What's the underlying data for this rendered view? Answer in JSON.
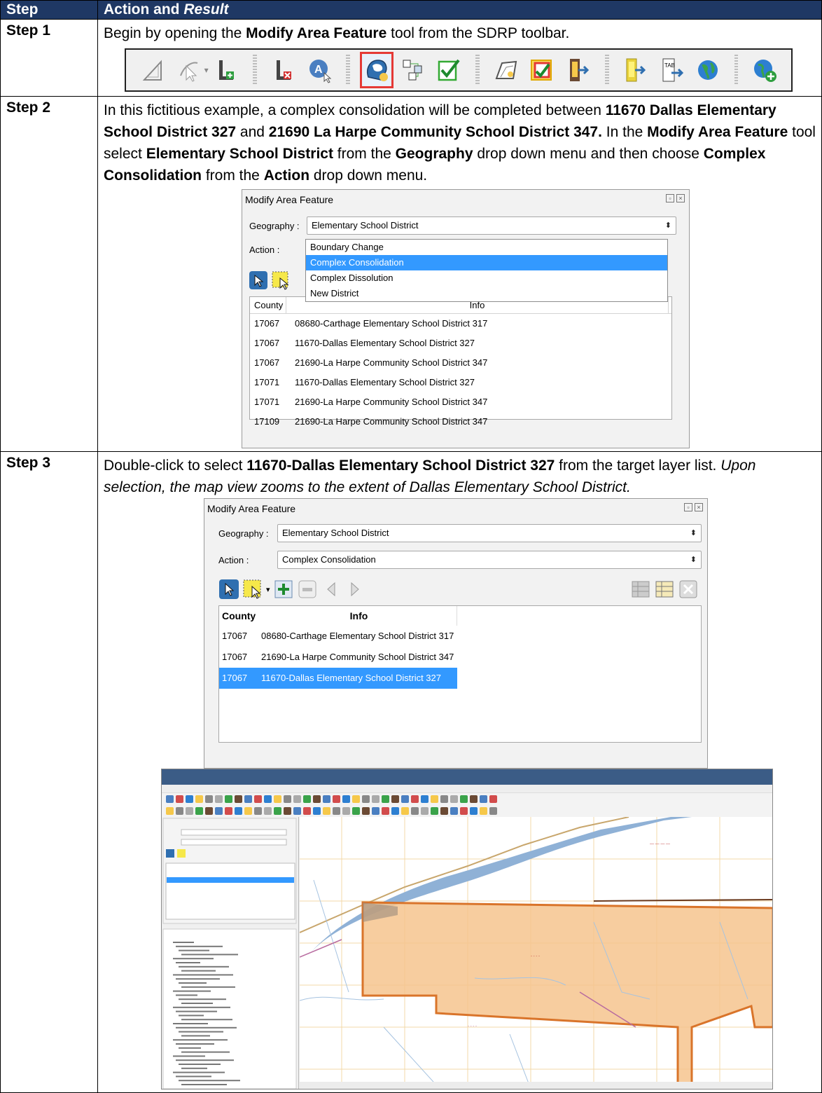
{
  "header": {
    "col_step": "Step",
    "col_action_a": "Action and ",
    "col_action_b": "Result"
  },
  "steps": [
    {
      "label": "Step 1",
      "text": [
        {
          "t": "Begin by opening the "
        },
        {
          "b": "Modify Area Feature"
        },
        {
          "t": " tool from the SDRP toolbar."
        }
      ],
      "toolbar_icons": [
        "measure-icon",
        "select-arrow-icon",
        "add-layer-icon",
        "remove-layer-icon",
        "label-icon",
        "modify-area-feature-icon",
        "topology-icon",
        "review-check-icon",
        "edit-shape-icon",
        "validate-icon",
        "export-icon",
        "import-icon",
        "tab-export-icon",
        "globe-icon",
        "add-globe-icon"
      ]
    },
    {
      "label": "Step 2",
      "text": [
        {
          "t": "In this fictitious example, a complex consolidation will be completed between "
        },
        {
          "b": "11670 Dallas Elementary School District 327"
        },
        {
          "t": " and "
        },
        {
          "b": "21690 La Harpe Community School District 347."
        },
        {
          "t": " In the "
        },
        {
          "b": "Modify Area Feature"
        },
        {
          "t": " tool select "
        },
        {
          "b": "Elementary School District"
        },
        {
          "t": " from the "
        },
        {
          "b": "Geography"
        },
        {
          "t": " drop down menu and then choose "
        },
        {
          "b": "Complex Consolidation"
        },
        {
          "t": " from the "
        },
        {
          "b": "Action"
        },
        {
          "t": " drop down menu."
        }
      ],
      "dialog": {
        "title": "Modify Area Feature",
        "geography_label": "Geography :",
        "geography_value": "Elementary School District",
        "action_label": "Action :",
        "action_options": [
          "Boundary Change",
          "Complex Consolidation",
          "Complex Dissolution",
          "New District"
        ],
        "action_selected": "Complex Consolidation",
        "col_county": "County",
        "col_info": "Info",
        "rows": [
          {
            "county": "17067",
            "info": "08680-Carthage Elementary School District 317"
          },
          {
            "county": "17067",
            "info": "11670-Dallas Elementary School District 327"
          },
          {
            "county": "17067",
            "info": "21690-La Harpe Community School District 347"
          },
          {
            "county": "17071",
            "info": "11670-Dallas Elementary School District 327"
          },
          {
            "county": "17071",
            "info": "21690-La Harpe Community School District 347"
          },
          {
            "county": "17109",
            "info": "21690-La Harpe Community School District 347"
          }
        ]
      }
    },
    {
      "label": "Step 3",
      "text": [
        {
          "t": "Double-click to select "
        },
        {
          "b": "11670-Dallas Elementary School District 327"
        },
        {
          "t": " from the target layer list. "
        },
        {
          "i": "Upon selection, the map view zooms to the extent of Dallas Elementary School District."
        }
      ],
      "dialog": {
        "title": "Modify Area Feature",
        "geography_label": "Geography :",
        "geography_value": "Elementary School District",
        "action_label": "Action :",
        "action_value": "Complex Consolidation",
        "col_county": "County",
        "col_info": "Info",
        "rows": [
          {
            "county": "17067",
            "info": "08680-Carthage Elementary School District 317"
          },
          {
            "county": "17067",
            "info": "21690-La Harpe Community School District 347"
          },
          {
            "county": "17067",
            "info": "11670-Dallas Elementary School District 327",
            "selected": true
          }
        ]
      }
    }
  ],
  "colors": {
    "header_bg": "#1f3864",
    "selection": "#3399ff",
    "district_fill": "#f6c48e",
    "district_outline": "#d9742a",
    "river": "#8fb1d6",
    "highlight": "#e53935"
  }
}
